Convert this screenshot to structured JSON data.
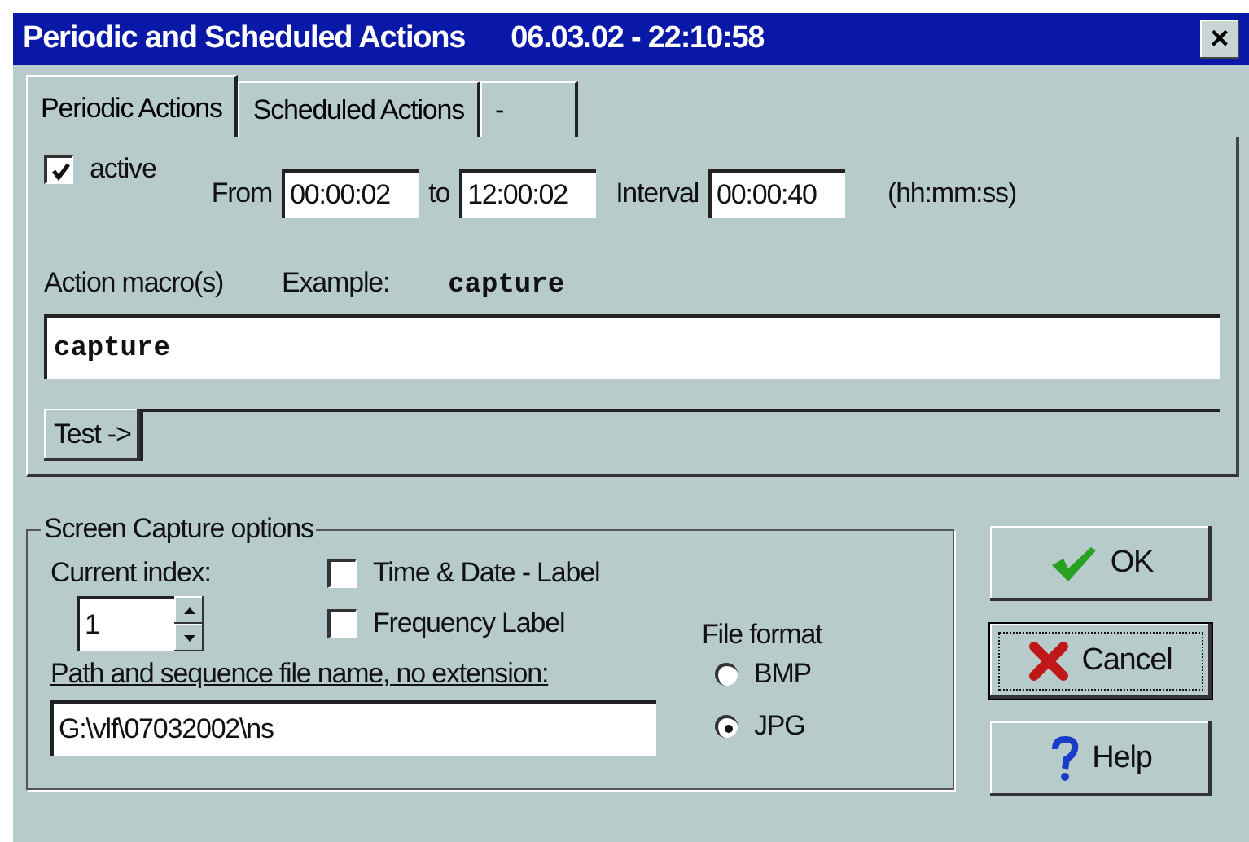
{
  "window": {
    "title": "Periodic and Scheduled Actions",
    "timestamp": "06.03.02 - 22:10:58",
    "close": "×"
  },
  "tabs": [
    {
      "label": "Periodic Actions",
      "selected": true
    },
    {
      "label": "Scheduled Actions",
      "selected": false
    },
    {
      "label": "-",
      "selected": false
    }
  ],
  "periodic": {
    "active": {
      "label": "active",
      "checked": true
    },
    "from": {
      "label": "From",
      "value": "00:00:02"
    },
    "to": {
      "label": "to",
      "value": "12:00:02"
    },
    "interval": {
      "label": "Interval",
      "value": "00:00:40"
    },
    "units": "(hh:mm:ss)",
    "macro_label": "Action macro(s)",
    "example_label": "Example:",
    "example_value": "capture",
    "macro_value": "capture",
    "test_button": "Test ->"
  },
  "capture": {
    "title": "Screen Capture options",
    "index_label": "Current index:",
    "index_value": "1",
    "options": [
      {
        "label": "Time & Date - Label",
        "checked": false
      },
      {
        "label": "Frequency Label",
        "checked": false
      }
    ],
    "path_label": "Path and sequence file name, no extension:",
    "path_value": "G:\\vlf\\07032002\\ns",
    "format_label": "File format",
    "formats": [
      {
        "label": "BMP",
        "selected": false
      },
      {
        "label": "JPG",
        "selected": true
      }
    ]
  },
  "buttons": [
    {
      "kind": "ok",
      "label": "OK",
      "focused": false
    },
    {
      "kind": "cancel",
      "label": "Cancel",
      "focused": true
    },
    {
      "kind": "help",
      "label": "Help",
      "focused": false
    }
  ]
}
